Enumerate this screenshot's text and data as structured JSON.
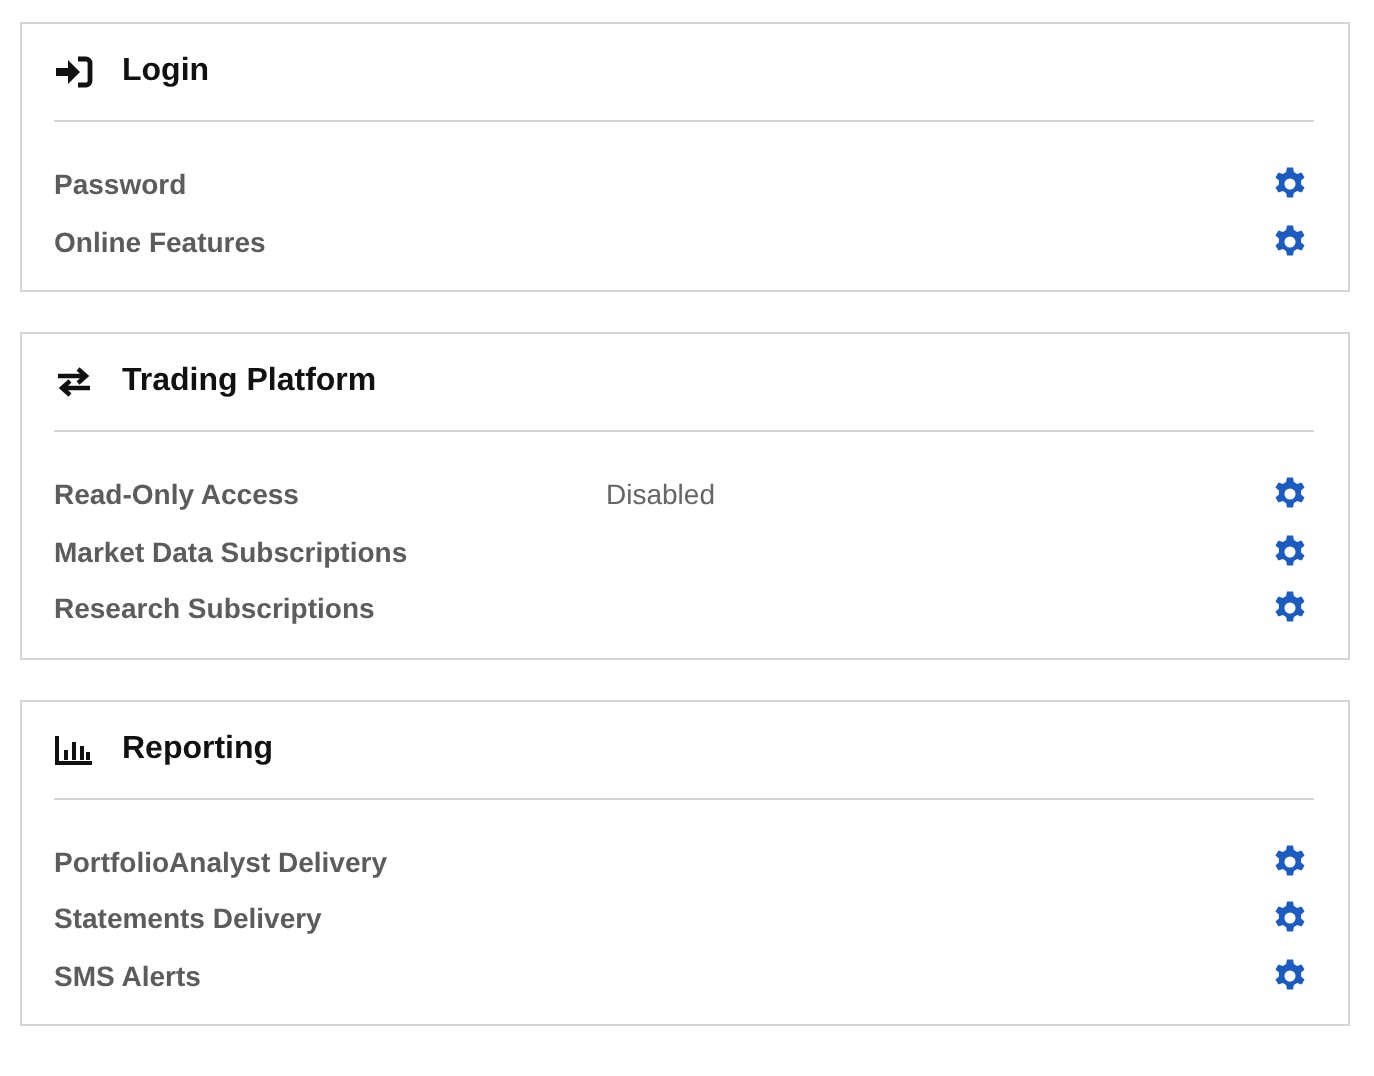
{
  "sections": [
    {
      "title": "Login",
      "kind": "login",
      "rows": [
        {
          "label": "Password"
        },
        {
          "label": "Online Features"
        }
      ]
    },
    {
      "title": "Trading Platform",
      "kind": "transfer",
      "rows": [
        {
          "label": "Read-Only Access",
          "value": "Disabled"
        },
        {
          "label": "Market Data Subscriptions"
        },
        {
          "label": "Research Subscriptions"
        }
      ]
    },
    {
      "title": "Reporting",
      "kind": "chart",
      "rows": [
        {
          "label": "PortfolioAnalyst Delivery"
        },
        {
          "label": "Statements Delivery"
        },
        {
          "label": "SMS Alerts"
        }
      ]
    }
  ]
}
